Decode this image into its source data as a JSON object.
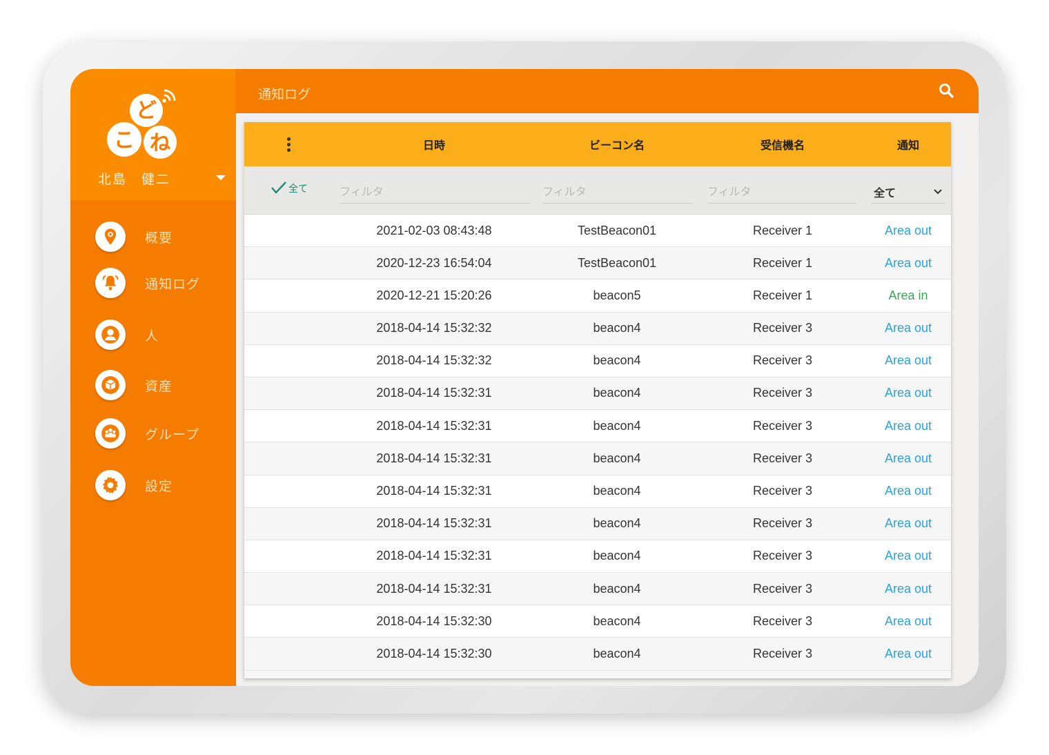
{
  "app": {
    "user_name": "北島　健二"
  },
  "sidebar": {
    "items": [
      {
        "label": "概要",
        "icon": "location-pin-icon"
      },
      {
        "label": "通知ログ",
        "icon": "bell-icon"
      },
      {
        "label": "人",
        "icon": "person-icon"
      },
      {
        "label": "資産",
        "icon": "box-icon"
      },
      {
        "label": "グループ",
        "icon": "group-icon"
      },
      {
        "label": "設定",
        "icon": "gear-icon"
      }
    ]
  },
  "topbar": {
    "title": "通知ログ",
    "search_icon": "search-icon"
  },
  "table": {
    "headers": {
      "date": "日時",
      "beacon": "ビーコン名",
      "receiver": "受信機名",
      "notify": "通知"
    },
    "filters": {
      "all_label": "全て",
      "date_placeholder": "フィルタ",
      "beacon_placeholder": "フィルタ",
      "receiver_placeholder": "フィルタ",
      "notify_selected": "全て"
    },
    "rows": [
      {
        "date": "2021-02-03 08:43:48",
        "beacon": "TestBeacon01",
        "receiver": "Receiver 1",
        "notify": "Area out"
      },
      {
        "date": "2020-12-23 16:54:04",
        "beacon": "TestBeacon01",
        "receiver": "Receiver 1",
        "notify": "Area out"
      },
      {
        "date": "2020-12-21 15:20:26",
        "beacon": "beacon5",
        "receiver": "Receiver 1",
        "notify": "Area in"
      },
      {
        "date": "2018-04-14 15:32:32",
        "beacon": "beacon4",
        "receiver": "Receiver 3",
        "notify": "Area out"
      },
      {
        "date": "2018-04-14 15:32:32",
        "beacon": "beacon4",
        "receiver": "Receiver 3",
        "notify": "Area out"
      },
      {
        "date": "2018-04-14 15:32:31",
        "beacon": "beacon4",
        "receiver": "Receiver 3",
        "notify": "Area out"
      },
      {
        "date": "2018-04-14 15:32:31",
        "beacon": "beacon4",
        "receiver": "Receiver 3",
        "notify": "Area out"
      },
      {
        "date": "2018-04-14 15:32:31",
        "beacon": "beacon4",
        "receiver": "Receiver 3",
        "notify": "Area out"
      },
      {
        "date": "2018-04-14 15:32:31",
        "beacon": "beacon4",
        "receiver": "Receiver 3",
        "notify": "Area out"
      },
      {
        "date": "2018-04-14 15:32:31",
        "beacon": "beacon4",
        "receiver": "Receiver 3",
        "notify": "Area out"
      },
      {
        "date": "2018-04-14 15:32:31",
        "beacon": "beacon4",
        "receiver": "Receiver 3",
        "notify": "Area out"
      },
      {
        "date": "2018-04-14 15:32:31",
        "beacon": "beacon4",
        "receiver": "Receiver 3",
        "notify": "Area out"
      },
      {
        "date": "2018-04-14 15:32:30",
        "beacon": "beacon4",
        "receiver": "Receiver 3",
        "notify": "Area out"
      },
      {
        "date": "2018-04-14 15:32:30",
        "beacon": "beacon4",
        "receiver": "Receiver 3",
        "notify": "Area out"
      }
    ]
  },
  "colors": {
    "primary_orange": "#f57c00",
    "header_amber": "#fbae1a",
    "area_out": "#29a3dc",
    "area_in": "#3aa655",
    "check_teal": "#1e8a72"
  }
}
